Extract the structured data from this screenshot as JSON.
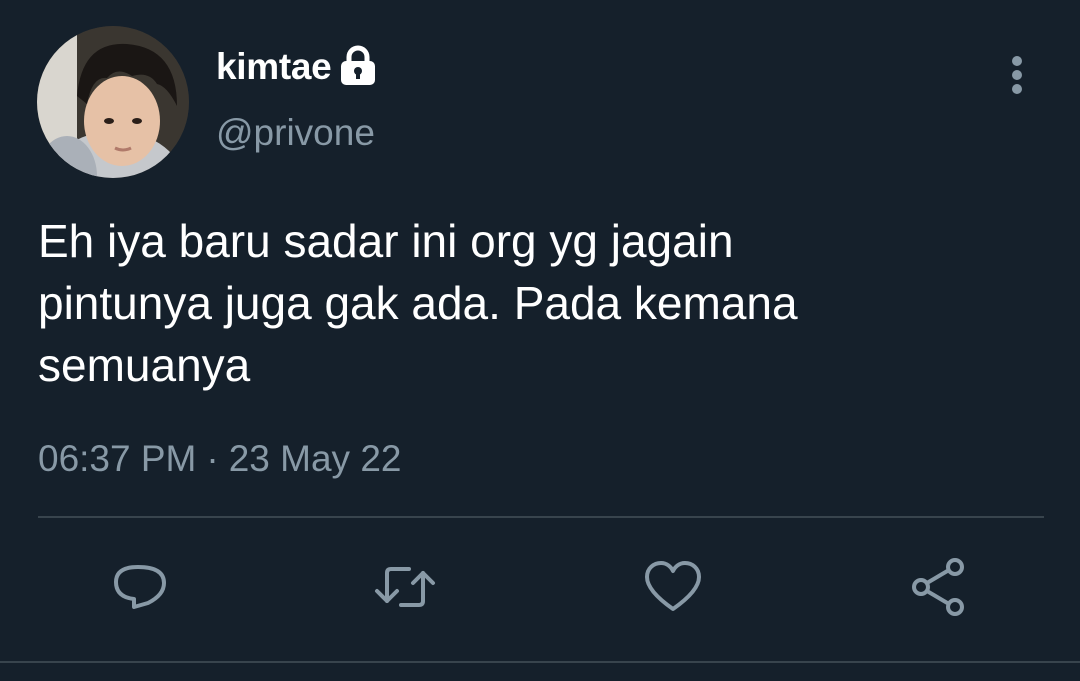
{
  "tweet": {
    "author": {
      "display_name": "kimtae",
      "handle": "@privone",
      "protected_icon": "lock-icon",
      "avatar": "profile-photo"
    },
    "text": "Eh iya baru sadar ini org yg jagain\npintunya juga gak ada. Pada kemana\nsemuanya",
    "time": "06:37 PM",
    "separator": "·",
    "date": "23 May 22",
    "menu_icon": "more-vertical-icon",
    "actions": [
      {
        "name": "reply",
        "icon": "comment-icon"
      },
      {
        "name": "retweet",
        "icon": "retweet-icon"
      },
      {
        "name": "like",
        "icon": "heart-icon"
      },
      {
        "name": "share",
        "icon": "share-icon"
      }
    ]
  },
  "colors": {
    "background": "#15202b",
    "primary_text": "#ffffff",
    "secondary_text": "#8899a6",
    "divider": "#38444d"
  }
}
